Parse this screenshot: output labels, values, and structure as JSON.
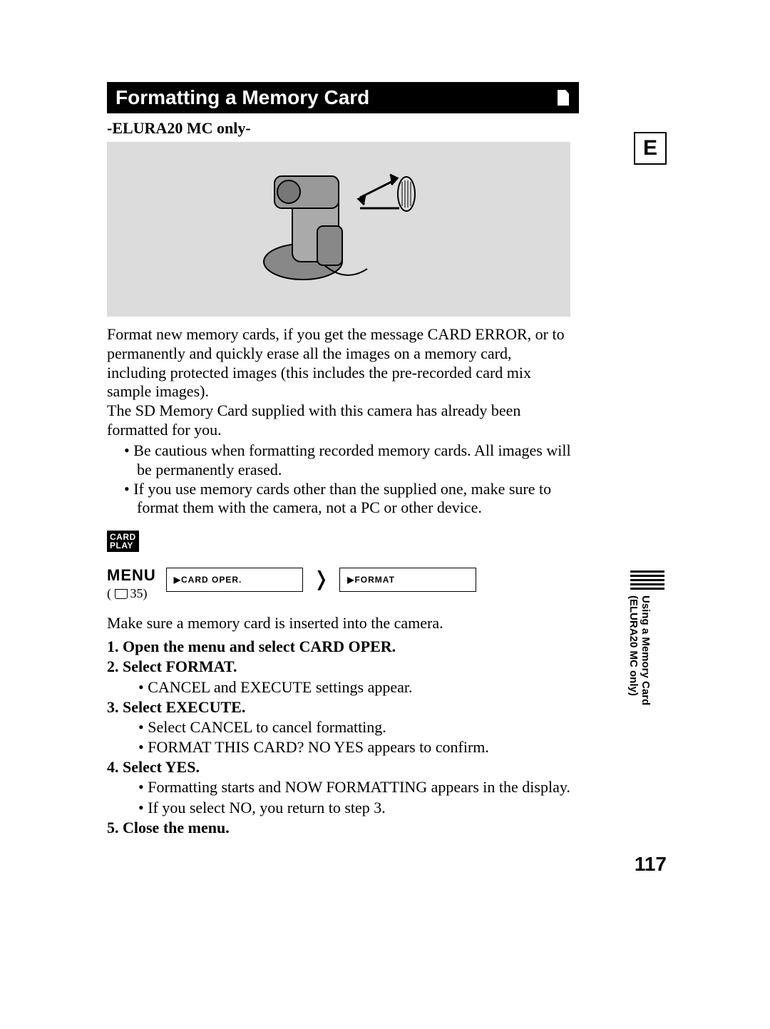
{
  "header": {
    "title": "Formatting a Memory Card",
    "language_badge": "E"
  },
  "subtitle": "-ELURA20 MC only-",
  "intro_paragraphs": [
    "Format new memory cards, if you get the message CARD ERROR, or to permanently and quickly erase all the images on a memory card, including protected images (this includes the pre-recorded card mix sample images).",
    "The SD Memory Card supplied with this camera has already been formatted for you."
  ],
  "intro_bullets": [
    "Be cautious when formatting recorded memory cards. All images will be permanently erased.",
    "If you use memory cards other than the supplied one, make sure to format them with the camera, not a PC or other device."
  ],
  "mode_tag_line1": "CARD",
  "mode_tag_line2": "PLAY",
  "menu": {
    "label": "MENU",
    "page_ref": "35",
    "path": [
      "▶CARD OPER.",
      "▶FORMAT"
    ]
  },
  "instruction_line": "Make sure a memory card is inserted into the camera.",
  "steps": [
    {
      "num": "1.",
      "title": "Open the menu and select CARD OPER.",
      "bullets": []
    },
    {
      "num": "2.",
      "title": "Select FORMAT.",
      "bullets": [
        "CANCEL and EXECUTE settings appear."
      ]
    },
    {
      "num": "3.",
      "title": "Select EXECUTE.",
      "bullets": [
        "Select CANCEL to cancel formatting.",
        "FORMAT THIS CARD? NO YES appears to confirm."
      ]
    },
    {
      "num": "4.",
      "title": "Select YES.",
      "bullets": [
        "Formatting starts and NOW FORMATTING appears in the display.",
        "If you select NO, you return to step 3."
      ]
    },
    {
      "num": "5.",
      "title": "Close the menu.",
      "bullets": []
    }
  ],
  "side_tab": {
    "line1": "Using a Memory Card",
    "line2": "(ELURA20 MC only)"
  },
  "page_number": "117"
}
